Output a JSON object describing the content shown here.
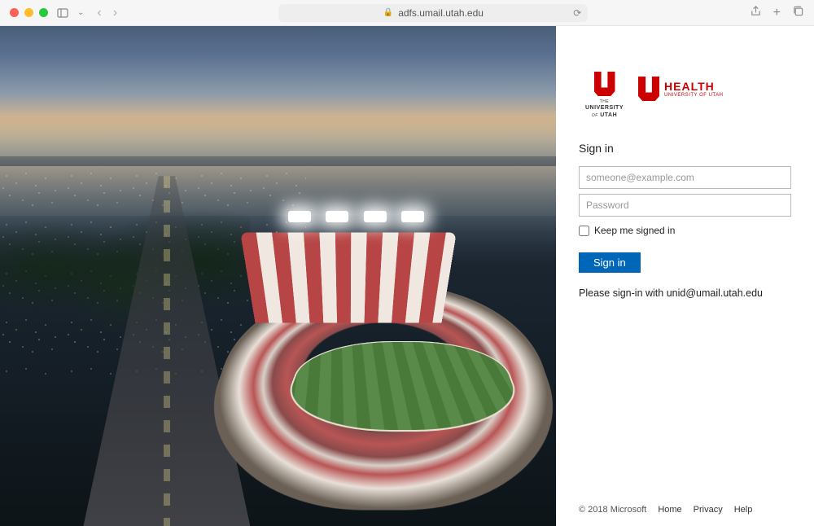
{
  "browser": {
    "url": "adfs.umail.utah.edu"
  },
  "logos": {
    "university": {
      "the": "THE",
      "university": "UNIVERSITY",
      "of": "OF",
      "utah": "UTAH"
    },
    "health": {
      "title": "HEALTH",
      "subtitle": "UNIVERSITY OF UTAH"
    }
  },
  "signin": {
    "title": "Sign in",
    "username_placeholder": "someone@example.com",
    "password_placeholder": "Password",
    "keep_signed_in_label": "Keep me signed in",
    "submit_label": "Sign in",
    "help_text": "Please sign-in with unid@umail.utah.edu"
  },
  "footer": {
    "copyright": "© 2018 Microsoft",
    "links": [
      "Home",
      "Privacy",
      "Help"
    ]
  }
}
